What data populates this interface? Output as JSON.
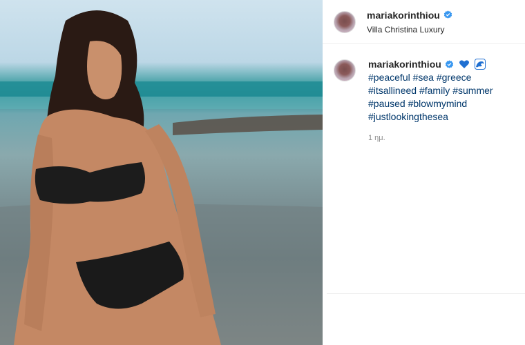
{
  "post": {
    "username": "mariakorinthiou",
    "location": "Villa Christina Luxury",
    "caption_username": "mariakorinthiou",
    "hashtags": [
      "#peaceful",
      "#sea",
      "#greece",
      "#itsallineed",
      "#family",
      "#summer",
      "#paused",
      "#blowmymind",
      "#justlookingthesea"
    ],
    "timestamp": "1 ημ."
  },
  "icons": {
    "verified": "verified-badge-icon",
    "heart": "blue-heart-emoji",
    "wave": "wave-emoji"
  },
  "colors": {
    "hashtag": "#00376b",
    "verified": "#3897f0",
    "heart": "#1f6fd1"
  }
}
